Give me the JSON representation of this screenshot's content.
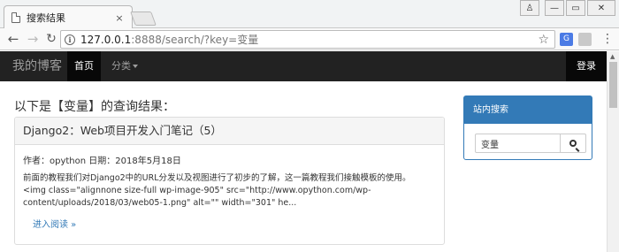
{
  "browser": {
    "tab_title": "搜索结果",
    "tab_close": "×",
    "url_host": "127.0.0.1",
    "url_rest": ":8888/search/?key=变量",
    "icons": [
      "page-icon",
      "info-icon",
      "star-icon",
      "translate-icon",
      "reader-icon",
      "menu-icon"
    ],
    "win_user": "♙",
    "win_min": "—",
    "win_max": "▭",
    "win_close": "✕"
  },
  "site": {
    "brand": "我的博客",
    "nav": {
      "home": "首页",
      "category": "分类",
      "login": "登录"
    },
    "colors": {
      "navbar": "#222222",
      "active": "#080808",
      "primary": "#337ab7",
      "link": "#337ab7"
    }
  },
  "results": {
    "heading": "以下是【变量】的查询结果：",
    "items": [
      {
        "title": "Django2：Web项目开发入门笔记（5）",
        "meta": "作者：opython 日期：2018年5月18日",
        "excerpt_lines": [
          "前面的教程我们对Django2中的URL分发以及视图进行了初步的了解，这一篇教程我们接触模板的使用。",
          "<img class=\"alignnone size-full wp-image-905\" src=\"http://www.opython.com/wp-",
          "content/uploads/2018/03/web05-1.png\" alt=\"\" width=\"301\" he..."
        ],
        "read_more": "进入阅读 »"
      }
    ]
  },
  "sidebar": {
    "title": "站内搜索",
    "search_value": "变量"
  }
}
